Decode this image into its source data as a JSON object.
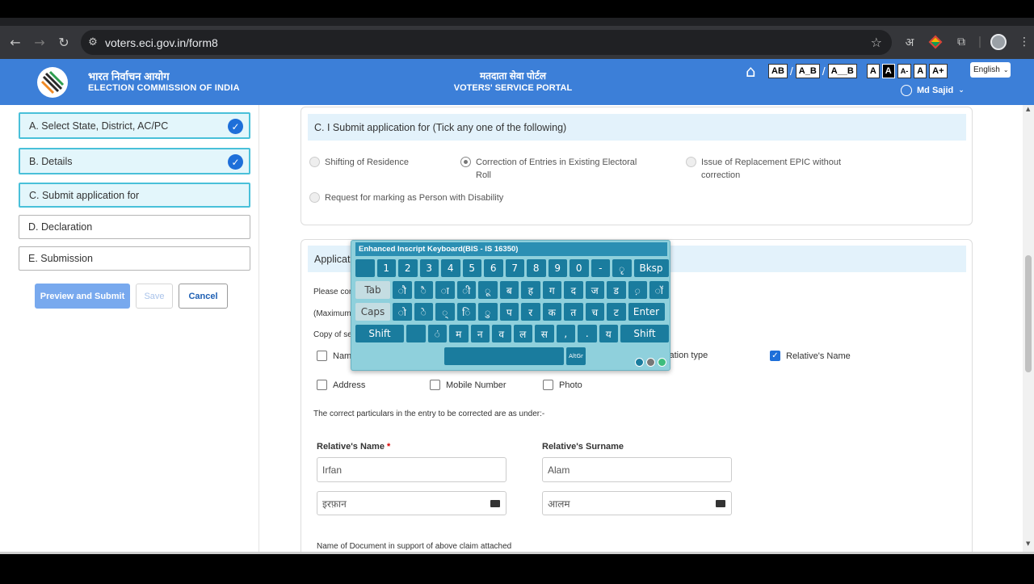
{
  "browser": {
    "url": "voters.eci.gov.in/form8",
    "icons": [
      "back-icon",
      "forward-icon",
      "reload-icon",
      "site-info-icon",
      "star-icon",
      "translate-icon",
      "extension-icon",
      "puzzle-icon",
      "profile-icon",
      "menu-icon"
    ],
    "translate_glyph": "अ"
  },
  "header": {
    "org_hi": "भारत निर्वाचन आयोग",
    "org_en": "ELECTION COMMISSION OF INDIA",
    "portal_hi": "मतदाता सेवा पोर्टल",
    "portal_en": "VOTERS' SERVICE PORTAL",
    "access_buttons": [
      "AB",
      "A_B",
      "A__B",
      "A",
      "A",
      "A-",
      "A",
      "A+"
    ],
    "language": "English",
    "user_name": "Md Sajid",
    "brand_color": "#3c7fd8"
  },
  "steps": [
    {
      "label": "A. Select State, District, AC/PC",
      "done": true
    },
    {
      "label": "B. Details",
      "done": true
    },
    {
      "label": "C. Submit application for",
      "done": false
    },
    {
      "label": "D. Declaration",
      "done": false
    },
    {
      "label": "E. Submission",
      "done": false
    }
  ],
  "actions": {
    "preview": "Preview and Submit",
    "save": "Save",
    "cancel": "Cancel"
  },
  "section_c": {
    "title": "C. I Submit application for (Tick any one of the following)",
    "options": [
      "Shifting of Residence",
      "Correction of Entries in Existing Electoral Roll",
      "Issue of Replacement EPIC without correction",
      "Request for marking as Person with Disability"
    ],
    "selected_index": 1
  },
  "section_app": {
    "title_partial": "Applicati",
    "line1": "Please cor",
    "line2": "(Maximum",
    "line3": "Copy of se",
    "checkboxes": [
      {
        "label": "Nam",
        "checked": false
      },
      {
        "label": "Relation type",
        "checked": false
      },
      {
        "label": "Relative's Name",
        "checked": true
      },
      {
        "label": "Address",
        "checked": false
      },
      {
        "label": "Mobile Number",
        "checked": false
      },
      {
        "label": "Photo",
        "checked": false
      }
    ],
    "correct_note": "The correct particulars in the entry to be corrected are as under:-",
    "relative_name_label": "Relative's Name",
    "required_mark": "*",
    "relative_surname_label": "Relative's Surname",
    "relative_name_en": "Irfan",
    "relative_surname_en": "Alam",
    "relative_name_hi": "इरफ़ान",
    "relative_surname_hi": "आलम",
    "doc_label": "Name of Document in support of above claim attached"
  },
  "keyboard": {
    "title": "Enhanced Inscript Keyboard(BIS - IS 16350)",
    "row1": [
      "",
      "1",
      "2",
      "3",
      "4",
      "5",
      "6",
      "7",
      "8",
      "9",
      "0",
      "-",
      "ृ",
      "Bksp"
    ],
    "row2": [
      "Tab",
      "ौ",
      "ै",
      "ा",
      "ी",
      "ू",
      "ब",
      "ह",
      "ग",
      "द",
      "ज",
      "ड",
      "़",
      "ॉ"
    ],
    "row3": [
      "Caps",
      "ो",
      "े",
      "्",
      "ि",
      "ु",
      "प",
      "र",
      "क",
      "त",
      "च",
      "ट",
      "Enter"
    ],
    "row4": [
      "Shift",
      "",
      "ं",
      "म",
      "न",
      "व",
      "ल",
      "स",
      ",",
      ".",
      "य",
      "Shift"
    ],
    "altgr": "AltGr",
    "dot_colors": [
      "#1a7c9e",
      "#777777",
      "#3dbd7d"
    ]
  }
}
